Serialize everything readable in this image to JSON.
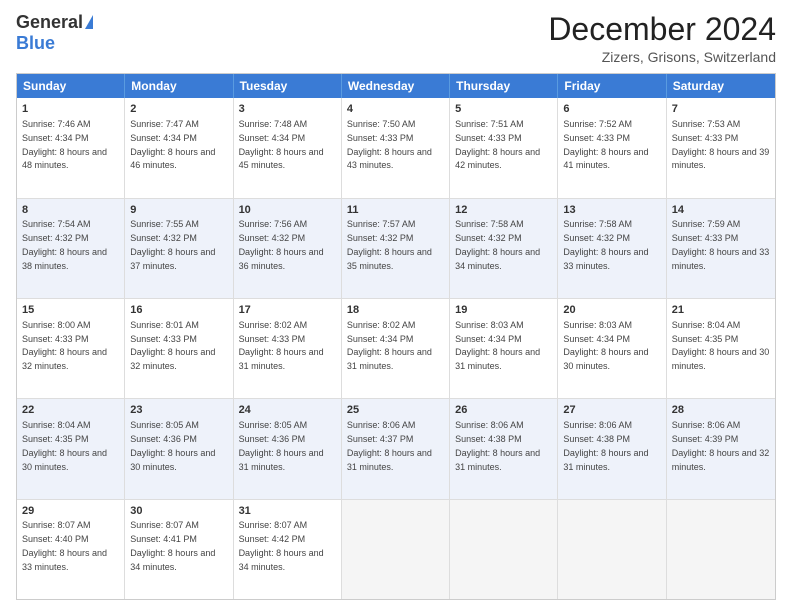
{
  "logo": {
    "general": "General",
    "blue": "Blue"
  },
  "title": "December 2024",
  "subtitle": "Zizers, Grisons, Switzerland",
  "days": [
    "Sunday",
    "Monday",
    "Tuesday",
    "Wednesday",
    "Thursday",
    "Friday",
    "Saturday"
  ],
  "weeks": [
    {
      "alt": false,
      "cells": [
        {
          "day": "1",
          "sunrise": "7:46 AM",
          "sunset": "4:34 PM",
          "daylight": "8 hours and 48 minutes."
        },
        {
          "day": "2",
          "sunrise": "7:47 AM",
          "sunset": "4:34 PM",
          "daylight": "8 hours and 46 minutes."
        },
        {
          "day": "3",
          "sunrise": "7:48 AM",
          "sunset": "4:34 PM",
          "daylight": "8 hours and 45 minutes."
        },
        {
          "day": "4",
          "sunrise": "7:50 AM",
          "sunset": "4:33 PM",
          "daylight": "8 hours and 43 minutes."
        },
        {
          "day": "5",
          "sunrise": "7:51 AM",
          "sunset": "4:33 PM",
          "daylight": "8 hours and 42 minutes."
        },
        {
          "day": "6",
          "sunrise": "7:52 AM",
          "sunset": "4:33 PM",
          "daylight": "8 hours and 41 minutes."
        },
        {
          "day": "7",
          "sunrise": "7:53 AM",
          "sunset": "4:33 PM",
          "daylight": "8 hours and 39 minutes."
        }
      ]
    },
    {
      "alt": true,
      "cells": [
        {
          "day": "8",
          "sunrise": "7:54 AM",
          "sunset": "4:32 PM",
          "daylight": "8 hours and 38 minutes."
        },
        {
          "day": "9",
          "sunrise": "7:55 AM",
          "sunset": "4:32 PM",
          "daylight": "8 hours and 37 minutes."
        },
        {
          "day": "10",
          "sunrise": "7:56 AM",
          "sunset": "4:32 PM",
          "daylight": "8 hours and 36 minutes."
        },
        {
          "day": "11",
          "sunrise": "7:57 AM",
          "sunset": "4:32 PM",
          "daylight": "8 hours and 35 minutes."
        },
        {
          "day": "12",
          "sunrise": "7:58 AM",
          "sunset": "4:32 PM",
          "daylight": "8 hours and 34 minutes."
        },
        {
          "day": "13",
          "sunrise": "7:58 AM",
          "sunset": "4:32 PM",
          "daylight": "8 hours and 33 minutes."
        },
        {
          "day": "14",
          "sunrise": "7:59 AM",
          "sunset": "4:33 PM",
          "daylight": "8 hours and 33 minutes."
        }
      ]
    },
    {
      "alt": false,
      "cells": [
        {
          "day": "15",
          "sunrise": "8:00 AM",
          "sunset": "4:33 PM",
          "daylight": "8 hours and 32 minutes."
        },
        {
          "day": "16",
          "sunrise": "8:01 AM",
          "sunset": "4:33 PM",
          "daylight": "8 hours and 32 minutes."
        },
        {
          "day": "17",
          "sunrise": "8:02 AM",
          "sunset": "4:33 PM",
          "daylight": "8 hours and 31 minutes."
        },
        {
          "day": "18",
          "sunrise": "8:02 AM",
          "sunset": "4:34 PM",
          "daylight": "8 hours and 31 minutes."
        },
        {
          "day": "19",
          "sunrise": "8:03 AM",
          "sunset": "4:34 PM",
          "daylight": "8 hours and 31 minutes."
        },
        {
          "day": "20",
          "sunrise": "8:03 AM",
          "sunset": "4:34 PM",
          "daylight": "8 hours and 30 minutes."
        },
        {
          "day": "21",
          "sunrise": "8:04 AM",
          "sunset": "4:35 PM",
          "daylight": "8 hours and 30 minutes."
        }
      ]
    },
    {
      "alt": true,
      "cells": [
        {
          "day": "22",
          "sunrise": "8:04 AM",
          "sunset": "4:35 PM",
          "daylight": "8 hours and 30 minutes."
        },
        {
          "day": "23",
          "sunrise": "8:05 AM",
          "sunset": "4:36 PM",
          "daylight": "8 hours and 30 minutes."
        },
        {
          "day": "24",
          "sunrise": "8:05 AM",
          "sunset": "4:36 PM",
          "daylight": "8 hours and 31 minutes."
        },
        {
          "day": "25",
          "sunrise": "8:06 AM",
          "sunset": "4:37 PM",
          "daylight": "8 hours and 31 minutes."
        },
        {
          "day": "26",
          "sunrise": "8:06 AM",
          "sunset": "4:38 PM",
          "daylight": "8 hours and 31 minutes."
        },
        {
          "day": "27",
          "sunrise": "8:06 AM",
          "sunset": "4:38 PM",
          "daylight": "8 hours and 31 minutes."
        },
        {
          "day": "28",
          "sunrise": "8:06 AM",
          "sunset": "4:39 PM",
          "daylight": "8 hours and 32 minutes."
        }
      ]
    },
    {
      "alt": false,
      "cells": [
        {
          "day": "29",
          "sunrise": "8:07 AM",
          "sunset": "4:40 PM",
          "daylight": "8 hours and 33 minutes."
        },
        {
          "day": "30",
          "sunrise": "8:07 AM",
          "sunset": "4:41 PM",
          "daylight": "8 hours and 34 minutes."
        },
        {
          "day": "31",
          "sunrise": "8:07 AM",
          "sunset": "4:42 PM",
          "daylight": "8 hours and 34 minutes."
        },
        {
          "day": "",
          "sunrise": "",
          "sunset": "",
          "daylight": ""
        },
        {
          "day": "",
          "sunrise": "",
          "sunset": "",
          "daylight": ""
        },
        {
          "day": "",
          "sunrise": "",
          "sunset": "",
          "daylight": ""
        },
        {
          "day": "",
          "sunrise": "",
          "sunset": "",
          "daylight": ""
        }
      ]
    }
  ],
  "labels": {
    "sunrise": "Sunrise:",
    "sunset": "Sunset:",
    "daylight": "Daylight:"
  }
}
